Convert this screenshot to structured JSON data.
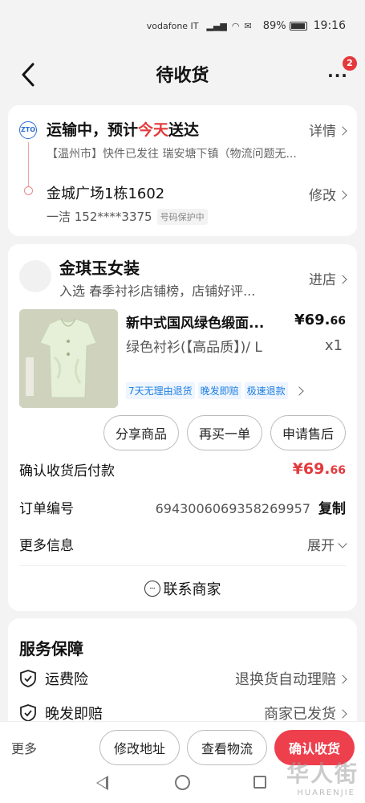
{
  "status_bar": {
    "carrier": "vodafone IT",
    "battery": "89%",
    "time": "19:16"
  },
  "nav": {
    "title": "待收货",
    "more_badge": "2"
  },
  "shipping": {
    "courier_logo": "ZTO",
    "status_prefix": "运输中，预计",
    "status_highlight": "今天",
    "status_suffix": "送达",
    "detail_link": "详情",
    "description": "【温州市】快件已发往 瑞安塘下镇（物流问题无...",
    "address": "金城广场1栋1602",
    "modify_link": "修改",
    "contact": "一洁 152****3375",
    "protect_tag": "号码保护中"
  },
  "order": {
    "store_name": "金琪玉女装",
    "store_sub": "入选 春季衬衫店铺榜，店铺好评...",
    "enter_store": "进店",
    "product": {
      "name": "新中式国风绿色缎面...",
      "price_main": "¥69.",
      "price_cents": "66",
      "spec": "绿色衬衫(【高品质】)/ L",
      "quantity": "x1",
      "tags": [
        "7天无理由退货",
        "晚发即赔",
        "极速退款"
      ]
    },
    "actions": {
      "share": "分享商品",
      "rebuy": "再买一单",
      "after_sale": "申请售后"
    },
    "payment_label": "确认收货后付款",
    "payment_main": "¥69.",
    "payment_cents": "66",
    "order_no_label": "订单编号",
    "order_no": "6943006069358269957",
    "copy": "复制",
    "more_info_label": "更多信息",
    "expand": "展开",
    "contact_seller": "联系商家"
  },
  "service": {
    "title": "服务保障",
    "items": [
      {
        "name": "运费险",
        "value": "退换货自动理赔"
      },
      {
        "name": "晚发即赔",
        "value": "商家已发货"
      }
    ]
  },
  "bottom_bar": {
    "more": "更多",
    "modify_address": "修改地址",
    "view_logistics": "查看物流",
    "confirm_receipt": "确认收货"
  },
  "watermark": {
    "text": "华人街",
    "sub": "HUARENJIE"
  },
  "colors": {
    "accent": "#e4393c",
    "primary_button": "#ee3f4d",
    "tag_blue": "#1d7fe0"
  }
}
